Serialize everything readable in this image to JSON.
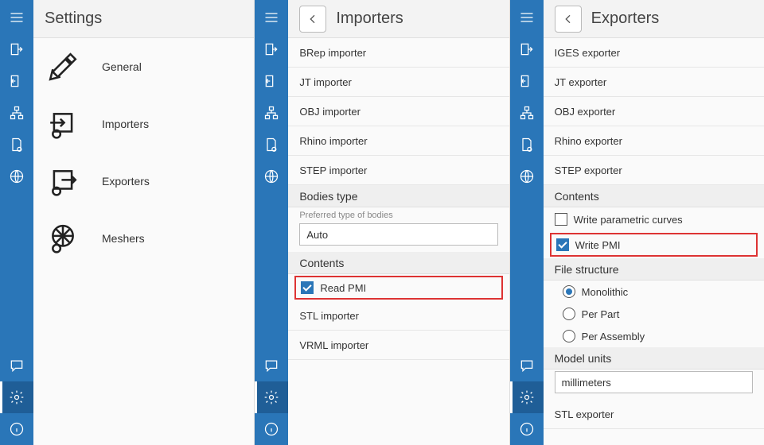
{
  "panel1": {
    "title": "Settings",
    "categories": [
      {
        "label": "General"
      },
      {
        "label": "Importers"
      },
      {
        "label": "Exporters"
      },
      {
        "label": "Meshers"
      }
    ]
  },
  "panel2": {
    "title": "Importers",
    "items_top": [
      "BRep importer",
      "JT importer",
      "OBJ importer",
      "Rhino importer",
      "STEP importer"
    ],
    "section_bodies": "Bodies type",
    "bodies_hint": "Preferred type of bodies",
    "bodies_value": "Auto",
    "section_contents": "Contents",
    "read_pmi": "Read PMI",
    "items_bottom": [
      "STL importer",
      "VRML importer"
    ]
  },
  "panel3": {
    "title": "Exporters",
    "items_top": [
      "IGES exporter",
      "JT exporter",
      "OBJ exporter",
      "Rhino exporter",
      "STEP exporter"
    ],
    "section_contents": "Contents",
    "write_param": "Write parametric curves",
    "write_pmi": "Write PMI",
    "section_file": "File structure",
    "radios": [
      {
        "label": "Monolithic",
        "selected": true
      },
      {
        "label": "Per Part",
        "selected": false
      },
      {
        "label": "Per Assembly",
        "selected": false
      }
    ],
    "section_units": "Model units",
    "units_value": "millimeters",
    "items_bottom": [
      "STL exporter"
    ]
  }
}
